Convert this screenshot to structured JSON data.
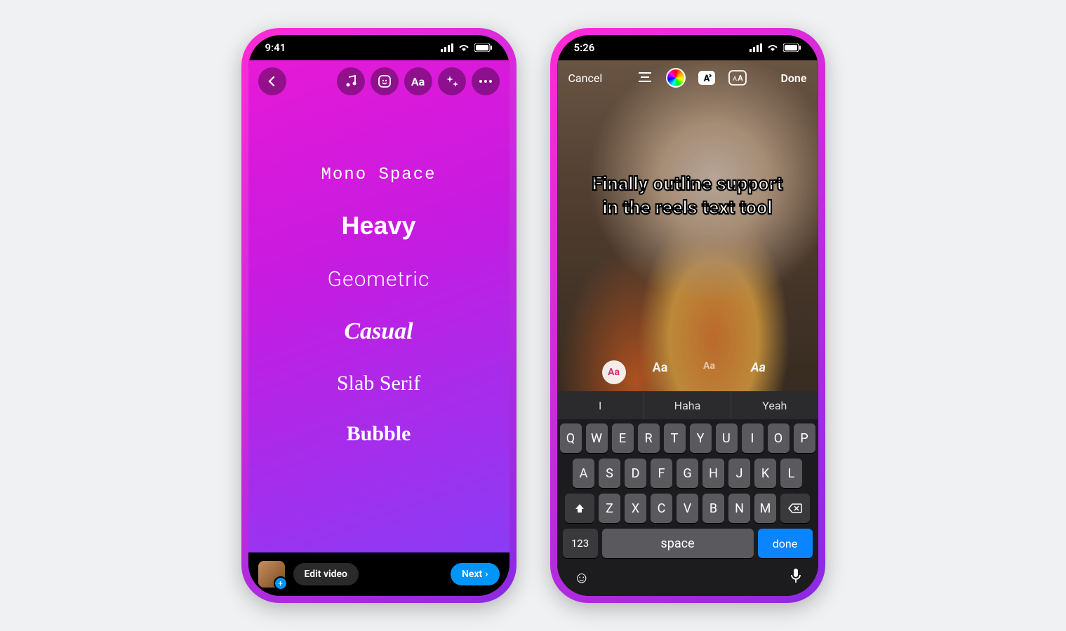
{
  "left": {
    "status_time": "9:41",
    "fonts": {
      "mono": "Mono Space",
      "heavy": "Heavy",
      "geo": "Geometric",
      "casual": "Casual",
      "slab": "Slab Serif",
      "bubble": "Bubble"
    },
    "edit_video_label": "Edit video",
    "next_label": "Next"
  },
  "right": {
    "status_time": "5:26",
    "cancel_label": "Cancel",
    "done_label": "Done",
    "caption_line1": "Finally outline support",
    "caption_line2": "in the reels text tool",
    "font_row": {
      "sel": "Aa",
      "a": "Aa",
      "b": "Aa",
      "c": "Aa"
    },
    "suggestions": {
      "a": "I",
      "b": "Haha",
      "c": "Yeah"
    },
    "keyboard": {
      "row1": [
        "Q",
        "W",
        "E",
        "R",
        "T",
        "Y",
        "U",
        "I",
        "O",
        "P"
      ],
      "row2": [
        "A",
        "S",
        "D",
        "F",
        "G",
        "H",
        "J",
        "K",
        "L"
      ],
      "row3": [
        "Z",
        "X",
        "C",
        "V",
        "B",
        "N",
        "M"
      ],
      "num": "123",
      "space": "space",
      "done": "done"
    }
  }
}
